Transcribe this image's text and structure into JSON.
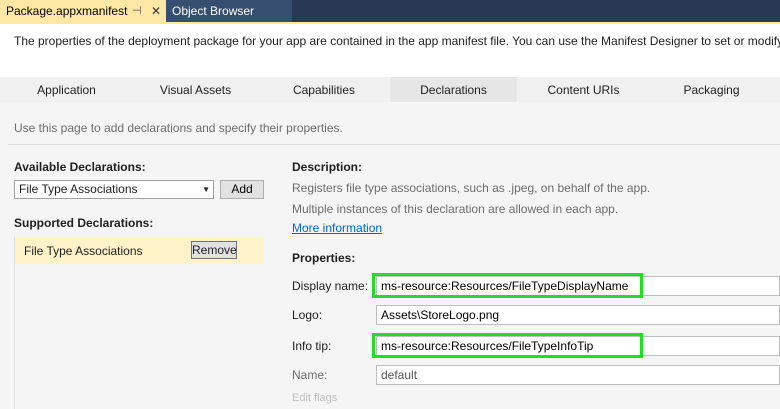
{
  "doc_tabs": {
    "active": "Package.appxmanifest",
    "pin_glyph": "⊣",
    "close_glyph": "✕",
    "inactive": "Object Browser"
  },
  "intro": "The properties of the deployment package for your app are contained in the app manifest file. You can use the Manifest Designer to set or modify",
  "tabs": [
    "Application",
    "Visual Assets",
    "Capabilities",
    "Declarations",
    "Content URIs",
    "Packaging"
  ],
  "selected_tab": "Declarations",
  "hint": "Use this page to add declarations and specify their properties.",
  "available": {
    "title": "Available Declarations:",
    "selected": "File Type Associations",
    "add_label": "Add"
  },
  "supported": {
    "title": "Supported Declarations:",
    "items": [
      {
        "label": "File Type Associations",
        "remove_label": "Remove"
      }
    ]
  },
  "description": {
    "title": "Description:",
    "line1": "Registers file type associations, such as .jpeg, on behalf of the app.",
    "line2": "Multiple instances of this declaration are allowed in each app.",
    "link": "More information"
  },
  "properties": {
    "title": "Properties:",
    "display_name": {
      "label": "Display name:",
      "value": "ms-resource:Resources/FileTypeDisplayName"
    },
    "logo": {
      "label": "Logo:",
      "value": "Assets\\StoreLogo.png"
    },
    "info_tip": {
      "label": "Info tip:",
      "value": "ms-resource:Resources/FileTypeInfoTip"
    },
    "name": {
      "label": "Name:",
      "value": "default"
    },
    "edit_flags": {
      "label": "Edit flags"
    }
  },
  "colors": {
    "active_tab": "#ffe8a6",
    "highlight": "#22dd22",
    "link": "#0066cc"
  }
}
